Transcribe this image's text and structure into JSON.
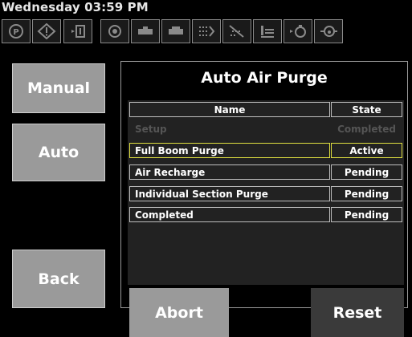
{
  "header": {
    "datetime": "Wednesday 03:59 PM"
  },
  "icons": [
    "parking-icon",
    "warning-diamond-icon",
    "tank-valve-icon",
    "pump-icon",
    "nozzle-icon",
    "nozzle-fill-icon",
    "section-flow-icon",
    "boom-spray-icon",
    "rinse-icon",
    "flow-valve-icon",
    "drip-valve-icon"
  ],
  "sidebar": {
    "manual_label": "Manual",
    "auto_label": "Auto",
    "back_label": "Back"
  },
  "panel": {
    "title": "Auto Air Purge",
    "columns": {
      "name": "Name",
      "state": "State"
    },
    "rows": [
      {
        "name": "Setup",
        "state": "Completed"
      },
      {
        "name": "Full Boom Purge",
        "state": "Active"
      },
      {
        "name": "Air Recharge",
        "state": "Pending"
      },
      {
        "name": "Individual Section Purge",
        "state": "Pending"
      },
      {
        "name": "Completed",
        "state": "Pending"
      }
    ],
    "abort_label": "Abort",
    "reset_label": "Reset"
  },
  "colors": {
    "button_gray": "#9a9a9a",
    "reset_dark": "#3a3a3a",
    "active_outline": "#e0e040"
  }
}
